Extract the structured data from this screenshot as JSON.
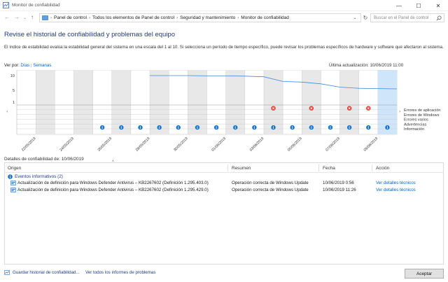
{
  "window": {
    "title": "Monitor de confiabilidad",
    "min_icon": "minimize-icon",
    "max_icon": "maximize-icon",
    "close_icon": "close-icon"
  },
  "address": {
    "crumbs": [
      "Panel de control",
      "Todos los elementos de Panel de control",
      "Seguridad y mantenimiento",
      "Monitor de confiabilidad"
    ],
    "search_placeholder": "Buscar en el Panel de control"
  },
  "page": {
    "heading": "Revise el historial de confiabilidad y problemas del equipo",
    "description": "El índice de estabilidad evalúa la estabilidad general del sistema en una escala del 1 al 10. Si selecciona un período de tiempo específico, puede revisar los problemas específicos de hardware y software que afectaron al sistema.",
    "view_by_label": "Ver por:",
    "view_days": "Días",
    "view_weeks": "Semanas",
    "last_update": "Última actualización: 10/06/2019 11:00"
  },
  "chart_data": {
    "type": "line",
    "ylim": [
      1,
      10
    ],
    "yticks": [
      "10",
      "5",
      "1"
    ],
    "columns": 20,
    "selected_column": 19,
    "x_labels": [
      "22/05/2019",
      "24/05/2019",
      "26/05/2019",
      "28/05/2019",
      "30/05/2019",
      "01/06/2019",
      "03/06/2019",
      "05/06/2019",
      "07/06/2019",
      "09/06/2019"
    ],
    "stability_index": [
      null,
      null,
      null,
      null,
      null,
      null,
      null,
      10,
      10,
      10,
      9.9,
      9.9,
      9.8,
      9.6,
      8.0,
      7.8,
      7.2,
      6.1,
      5.7,
      5.6,
      5.5
    ],
    "row_labels": [
      "Errores de aplicación",
      "Errores de Windows",
      "Errores varios",
      "Advertencias",
      "Información"
    ],
    "app_error_columns": [
      13,
      15,
      17,
      18
    ],
    "info_columns": [
      4,
      5,
      6,
      7,
      8,
      9,
      10,
      11,
      12,
      13,
      14,
      15,
      16,
      17,
      18,
      19
    ],
    "colors": {
      "line": "#3d8ae0",
      "error": "#e53935",
      "info": "#1976d2",
      "selected": "#cfe5fa",
      "grid": "#c8c8c8",
      "shade": "#e8e8e8"
    }
  },
  "details": {
    "label": "Detalles de confiabilidad de: 10/06/2019",
    "columns": {
      "origen": "Origen",
      "resumen": "Resumen",
      "fecha": "Fecha",
      "accion": "Acción"
    },
    "group": "Eventos informativos (2)",
    "rows": [
      {
        "origen": "Actualización de definición para Windows Defender Antivirus – KB2267602 (Definición 1.295.403.0)",
        "resumen": "Operación correcta de Windows Update",
        "fecha": "10/06/2019 0:56",
        "accion": "Ver detalles técnicos"
      },
      {
        "origen": "Actualización de definición para Windows Defender Antivirus – KB2267602 (Definición 1.295.429.0)",
        "resumen": "Operación correcta de Windows Update",
        "fecha": "10/06/2019 11:26",
        "accion": "Ver detalles técnicos"
      }
    ]
  },
  "footer": {
    "save_history": "Guardar historial de confiabilidad...",
    "view_reports": "Ver todos los informes de problemas",
    "accept": "Aceptar"
  }
}
